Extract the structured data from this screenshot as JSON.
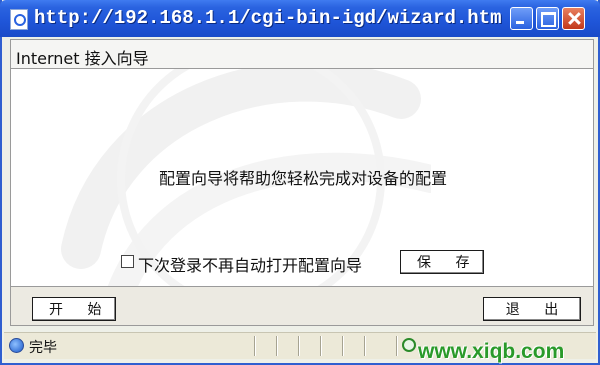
{
  "window": {
    "title": "http://192.168.1.1/cgi-bin-igd/wizard.htm -..."
  },
  "header": {
    "title": "Internet 接入向导"
  },
  "main": {
    "message": "配置向导将帮助您轻松完成对设备的配置",
    "checkbox_label": "下次登录不再自动打开配置向导",
    "checkbox_checked": false,
    "save_label": "保 存"
  },
  "footer": {
    "start_label": "开 始",
    "exit_label": "退 出"
  },
  "statusbar": {
    "text": "完毕"
  },
  "overlay": {
    "watermark_text": "www.xiqb.com"
  },
  "colors": {
    "titlebar": "#2a63e0",
    "watermark_green": "#2a9a2a"
  },
  "icons": [
    "page-icon",
    "minimize-icon",
    "maximize-icon",
    "close-icon",
    "ie-status-icon",
    "zone-icon"
  ]
}
